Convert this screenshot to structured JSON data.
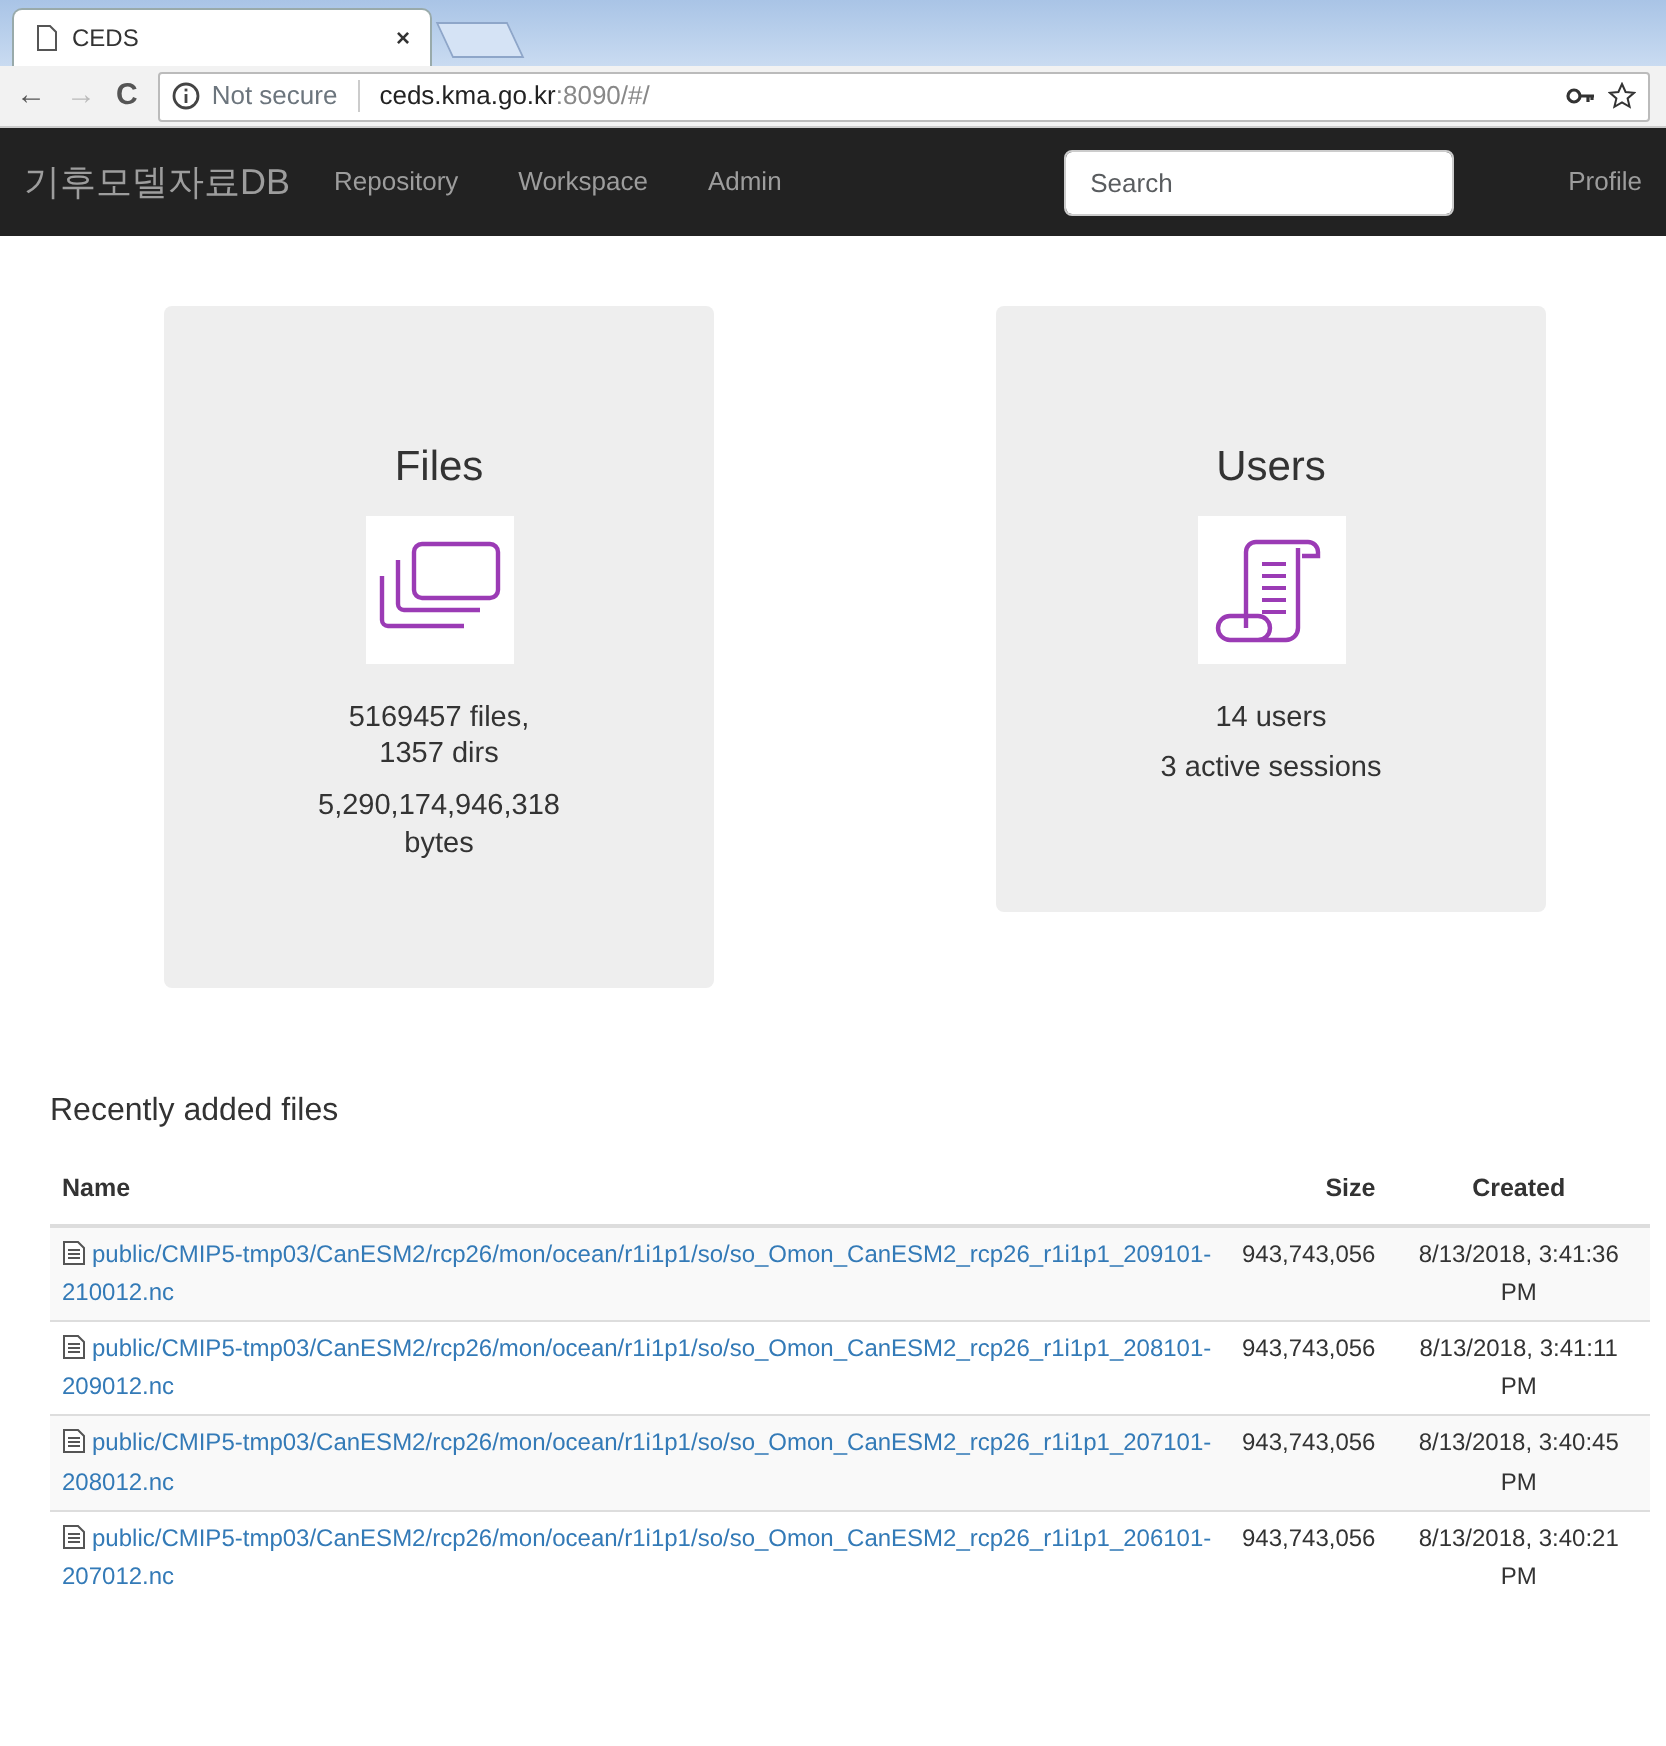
{
  "browser_tab": {
    "title": "CEDS",
    "close": "×"
  },
  "toolbar": {
    "back": "←",
    "forward": "→",
    "reload": "C"
  },
  "address_bar": {
    "security": "Not secure",
    "host": "ceds.kma.go.kr",
    "path": ":8090/#/"
  },
  "navbar": {
    "brand": "기후모델자료DB",
    "links": [
      "Repository",
      "Workspace",
      "Admin"
    ],
    "search": {
      "placeholder": "Search"
    },
    "profile": "Profile"
  },
  "stats": [
    {
      "kind": "files",
      "title": "Files",
      "lines": [
        "5169457 files, 1357 dirs",
        "5,290,174,946,318 bytes"
      ]
    },
    {
      "kind": "users",
      "title": "Users",
      "lines": [
        "14 users",
        "3 active sessions"
      ]
    }
  ],
  "recent": {
    "heading": "Recently added files",
    "columns": [
      "Name",
      "Size",
      "Created"
    ],
    "rows": [
      {
        "name": "public/CMIP5-tmp03/CanESM2/rcp26/mon/ocean/r1i1p1/so/so_Omon_CanESM2_rcp26_r1i1p1_209101-210012.nc",
        "size": "943,743,056",
        "created": "8/13/2018, 3:41:36 PM"
      },
      {
        "name": "public/CMIP5-tmp03/CanESM2/rcp26/mon/ocean/r1i1p1/so/so_Omon_CanESM2_rcp26_r1i1p1_208101-209012.nc",
        "size": "943,743,056",
        "created": "8/13/2018, 3:41:11 PM"
      },
      {
        "name": "public/CMIP5-tmp03/CanESM2/rcp26/mon/ocean/r1i1p1/so/so_Omon_CanESM2_rcp26_r1i1p1_207101-208012.nc",
        "size": "943,743,056",
        "created": "8/13/2018, 3:40:45 PM"
      },
      {
        "name": "public/CMIP5-tmp03/CanESM2/rcp26/mon/ocean/r1i1p1/so/so_Omon_CanESM2_rcp26_r1i1p1_206101-207012.nc",
        "size": "943,743,056",
        "created": "8/13/2018, 3:40:21 PM"
      }
    ]
  }
}
